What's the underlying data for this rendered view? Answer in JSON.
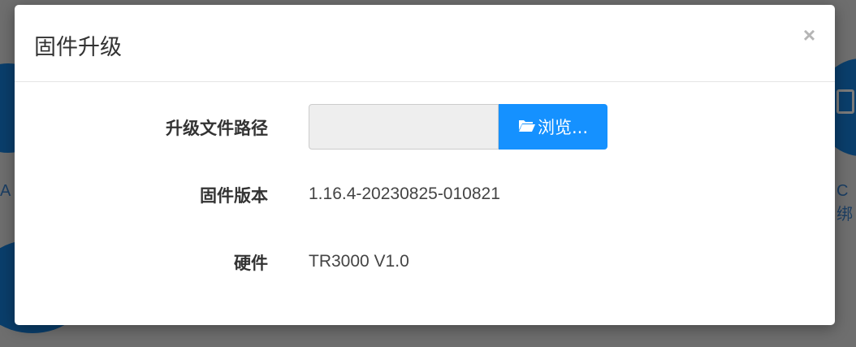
{
  "modal": {
    "title": "固件升级",
    "close_glyph": "×"
  },
  "form": {
    "path_label": "升级文件路径",
    "path_value": "",
    "browse_label": "浏览...",
    "browse_icon": "folder-open-icon",
    "version_label": "固件版本",
    "version_value": "1.16.4-20230825-010821",
    "hardware_label": "硬件",
    "hardware_value": "TR3000 V1.0"
  },
  "background": {
    "left_text_fragment": "A",
    "right_text_fragment": "C绑"
  },
  "colors": {
    "accent": "#1591ff",
    "overlay": "#6e6e6e",
    "input_bg": "#eeeeee"
  }
}
